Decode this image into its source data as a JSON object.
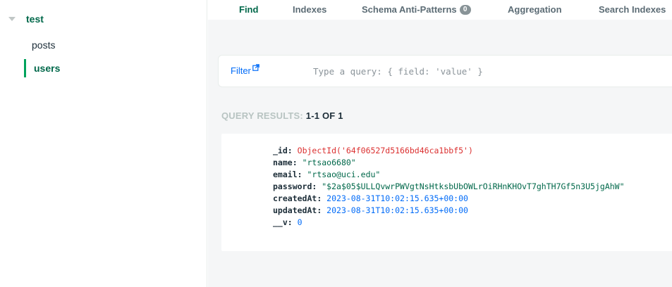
{
  "sidebar": {
    "database": "test",
    "collections": [
      {
        "label": "posts",
        "active": false
      },
      {
        "label": "users",
        "active": true
      }
    ]
  },
  "tabs": [
    {
      "label": "Find",
      "active": true
    },
    {
      "label": "Indexes",
      "active": false
    },
    {
      "label": "Schema Anti-Patterns",
      "active": false,
      "badge": "0"
    },
    {
      "label": "Aggregation",
      "active": false
    },
    {
      "label": "Search Indexes",
      "active": false
    }
  ],
  "filter": {
    "label": "Filter",
    "icon": "external-link-icon",
    "placeholder": "Type a query: { field: 'value' }",
    "value": ""
  },
  "results": {
    "label": "QUERY RESULTS:",
    "count": "1-1 OF 1"
  },
  "document": {
    "fields": [
      {
        "key": "_id",
        "value": "ObjectId('64f06527d5166bd46ca1bbf5')",
        "type": "oid"
      },
      {
        "key": "name",
        "value": "\"rtsao6680\"",
        "type": "str"
      },
      {
        "key": "email",
        "value": "\"rtsao@uci.edu\"",
        "type": "str"
      },
      {
        "key": "password",
        "value": "\"$2a$05$ULLQvwrPWVgtNsHtksbUbOWLrOiRHnKHOvT7ghTH7Gf5n3U5jgAhW\"",
        "type": "str"
      },
      {
        "key": "createdAt",
        "value": "2023-08-31T10:02:15.635+00:00",
        "type": "date"
      },
      {
        "key": "updatedAt",
        "value": "2023-08-31T10:02:15.635+00:00",
        "type": "date"
      },
      {
        "key": "__v",
        "value": "0",
        "type": "num"
      }
    ]
  },
  "colors": {
    "accent_green": "#00684a",
    "link_blue": "#016bf8",
    "oid_red": "#db3030"
  }
}
